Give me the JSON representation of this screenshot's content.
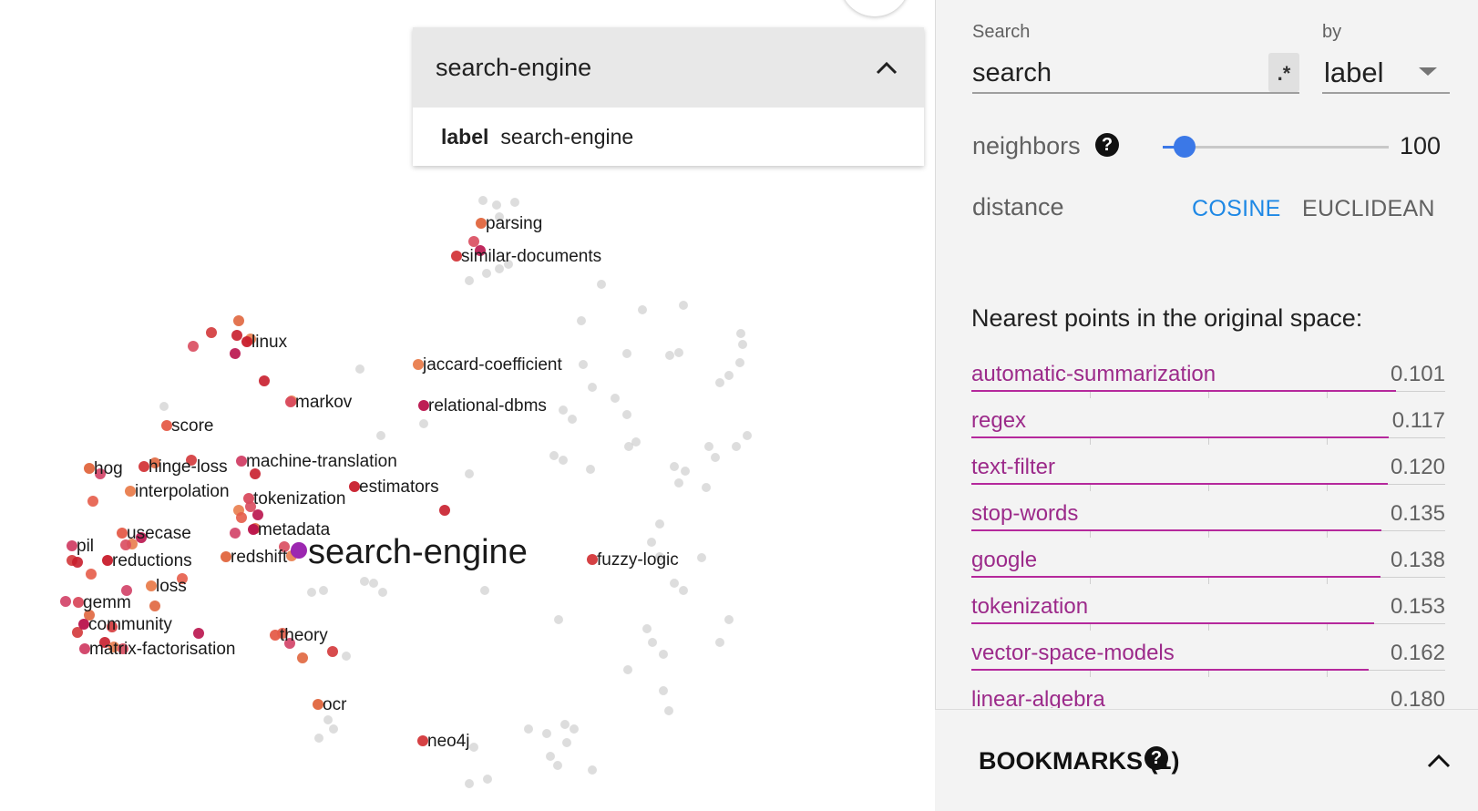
{
  "selected_point": {
    "title": "search-engine",
    "metadata": [
      {
        "key": "label",
        "value": "search-engine"
      }
    ]
  },
  "projection": {
    "highlight_label": "search-engine",
    "point_labels": [
      "parsing",
      "similar-documents",
      "linux",
      "jaccard-coefficient",
      "markov",
      "relational-dbms",
      "score",
      "machine-translation",
      "hog",
      "hinge-loss",
      "estimators",
      "interpolation",
      "tokenization",
      "metadata",
      "usecase",
      "pil",
      "redshift",
      "fuzzy-logic",
      "reductions",
      "loss",
      "gemm",
      "community",
      "theory",
      "matrix-factorisation",
      "ocr",
      "neo4j"
    ]
  },
  "search": {
    "label": "Search",
    "value": "search",
    "regex_label": ".*",
    "by_label": "by",
    "by_value": "label"
  },
  "neighbors": {
    "label": "neighbors",
    "value": "100",
    "fraction": 0.03
  },
  "distance": {
    "label": "distance",
    "options": [
      "COSINE",
      "EUCLIDEAN"
    ],
    "selected": "COSINE"
  },
  "nearest": {
    "title": "Nearest points in the original space:",
    "items": [
      {
        "name": "automatic-summarization",
        "distance": "0.101"
      },
      {
        "name": "regex",
        "distance": "0.117"
      },
      {
        "name": "text-filter",
        "distance": "0.120"
      },
      {
        "name": "stop-words",
        "distance": "0.135"
      },
      {
        "name": "google",
        "distance": "0.138"
      },
      {
        "name": "tokenization",
        "distance": "0.153"
      },
      {
        "name": "vector-space-models",
        "distance": "0.162"
      },
      {
        "name": "linear-algebra",
        "distance": "0.180"
      }
    ]
  },
  "bookmarks": {
    "title": "BOOKMARKS (1)"
  },
  "colors": {
    "accent": "#1e88e5",
    "neighbor_link": "#9c2a8a",
    "slider": "#3b78e7"
  }
}
